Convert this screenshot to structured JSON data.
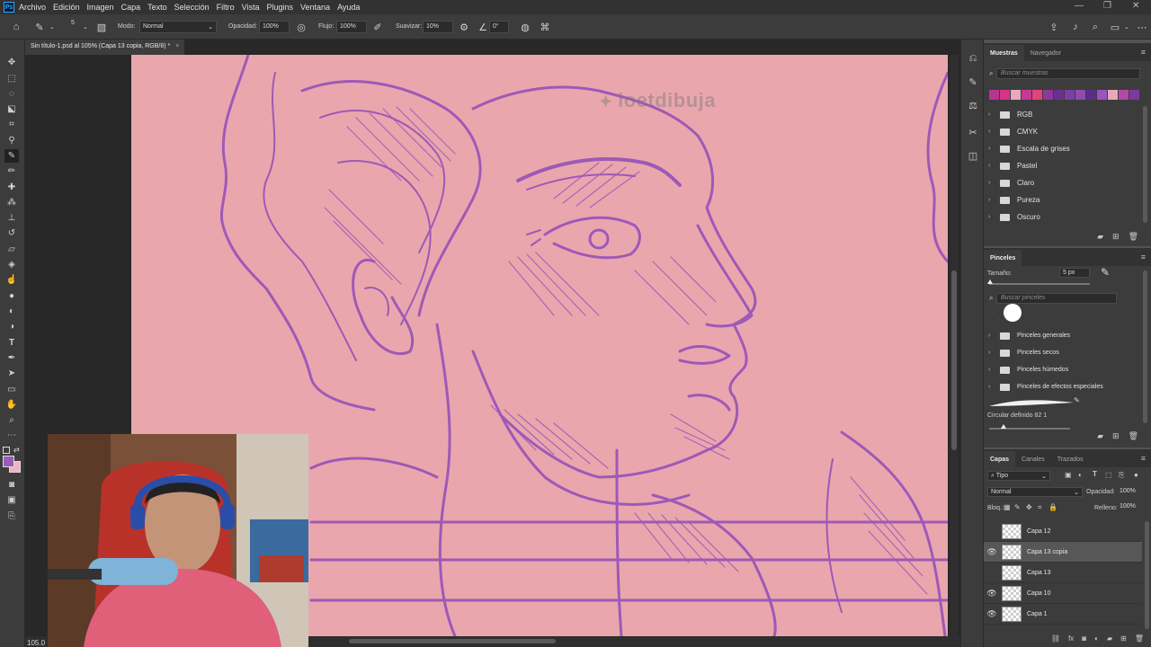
{
  "menu": {
    "items": [
      "Archivo",
      "Edición",
      "Imagen",
      "Capa",
      "Texto",
      "Selección",
      "Filtro",
      "Vista",
      "Plugins",
      "Ventana",
      "Ayuda"
    ],
    "logo": "Ps"
  },
  "options": {
    "brush_size": "5",
    "mode_label": "Modo:",
    "mode_value": "Normal",
    "opacity_label": "Opacidad:",
    "opacity_value": "100%",
    "flow_label": "Flujo:",
    "flow_value": "100%",
    "smooth_label": "Suavizar:",
    "smooth_value": "10%",
    "angle_value": "0°"
  },
  "document": {
    "tab_title": "Sin título-1.psd al 105% (Capa 13 copia, RGB/8) *",
    "zoom": "105.0",
    "watermark": "ioetdibuja",
    "canvas_color": "#e9a7ad",
    "stroke_color": "#9b55b8"
  },
  "swatches_panel": {
    "tabs": [
      "Muestras",
      "Navegador"
    ],
    "search_placeholder": "Buscar muestras",
    "swatch_colors": [
      "#b5368e",
      "#d63484",
      "#e9a7c1",
      "#c23b96",
      "#e0457b",
      "#8b3a9a",
      "#6d2f8e",
      "#7a3fa6",
      "#8e4cb0",
      "#5b2d86",
      "#9a55c0",
      "#e8a8b8",
      "#b04aa8",
      "#7c3a9e"
    ],
    "groups": [
      "RGB",
      "CMYK",
      "Escala de grises",
      "Pastel",
      "Claro",
      "Pureza",
      "Oscuro"
    ]
  },
  "brushes_panel": {
    "title": "Pinceles",
    "size_label": "Tamaño:",
    "size_value": "5 px",
    "search_placeholder": "Buscar pinceles",
    "groups": [
      "Pinceles generales",
      "Pinceles secos",
      "Pinceles húmedos",
      "Pinceles de efectos especiales"
    ],
    "current_brush": "Circular definido 82 1"
  },
  "layers_panel": {
    "tabs": [
      "Capas",
      "Canales",
      "Trazados"
    ],
    "kind_filter": "Tipo",
    "blend_mode": "Normal",
    "opacity_label": "Opacidad:",
    "opacity_value": "100%",
    "lock_label": "Bloq.:",
    "fill_label": "Relleno:",
    "fill_value": "100%",
    "layers": [
      {
        "name": "Capa 12",
        "visible": false,
        "selected": false
      },
      {
        "name": "Capa 13 copia",
        "visible": true,
        "selected": true
      },
      {
        "name": "Capa 13",
        "visible": false,
        "selected": false
      },
      {
        "name": "Capa 10",
        "visible": true,
        "selected": false
      },
      {
        "name": "Capa 1",
        "visible": true,
        "selected": false
      }
    ]
  },
  "colors": {
    "foreground": "#9a5cb8",
    "background": "#f0b3c3"
  }
}
